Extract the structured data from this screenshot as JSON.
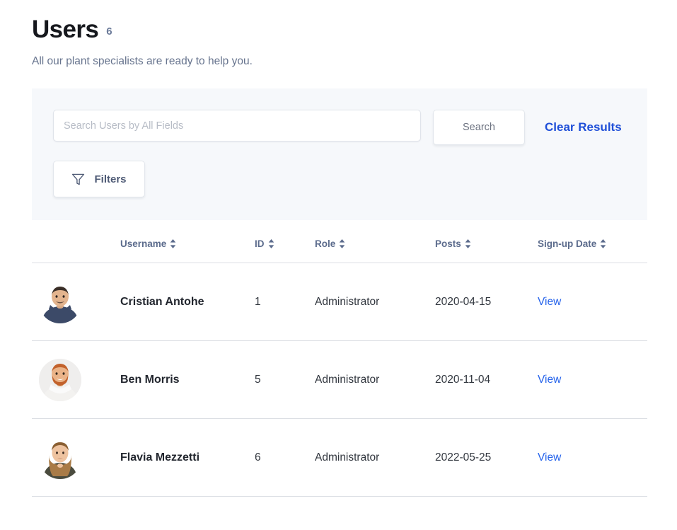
{
  "header": {
    "title": "Users",
    "count": "6",
    "subtitle": "All our plant specialists are ready to help you."
  },
  "search": {
    "placeholder": "Search Users by All Fields",
    "value": "",
    "search_label": "Search",
    "clear_label": "Clear Results",
    "filters_label": "Filters",
    "filters_icon": "funnel-icon",
    "panel_bg": "#f6f8fb",
    "link_color": "#1f4fd8"
  },
  "table": {
    "columns": [
      {
        "key": "avatar",
        "label": "",
        "sortable": false
      },
      {
        "key": "username",
        "label": "Username",
        "sortable": true
      },
      {
        "key": "id",
        "label": "ID",
        "sortable": true
      },
      {
        "key": "role",
        "label": "Role",
        "sortable": true
      },
      {
        "key": "posts",
        "label": "Posts",
        "sortable": true
      },
      {
        "key": "date",
        "label": "Sign-up Date",
        "sortable": true
      }
    ],
    "sort_icon": "sort-updown-icon",
    "rows": [
      {
        "avatar": "avatar-photo-male-dark-shirt",
        "avatar_bg": "#ffffff",
        "username": "Cristian Antohe",
        "id": "1",
        "role": "Administrator",
        "posts": "2020-04-15",
        "date": "View",
        "date_is_link": true
      },
      {
        "avatar": "avatar-photo-male-beard",
        "avatar_bg": "#efeeed",
        "username": "Ben Morris",
        "id": "5",
        "role": "Administrator",
        "posts": "2020-11-04",
        "date": "View",
        "date_is_link": true
      },
      {
        "avatar": "avatar-photo-female-long-hair",
        "avatar_bg": "#ffffff",
        "username": "Flavia Mezzetti",
        "id": "6",
        "role": "Administrator",
        "posts": "2022-05-25",
        "date": "View",
        "date_is_link": true
      }
    ]
  }
}
